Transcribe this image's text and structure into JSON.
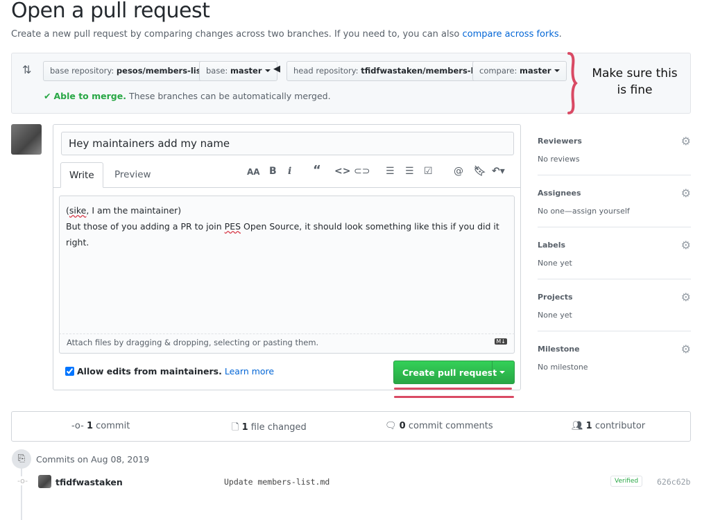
{
  "page": {
    "title": "Open a pull request",
    "subtitle": "Create a new pull request by comparing changes across two branches. If you need to, you can also ",
    "subtitle_link": "compare across forks",
    "subtitle_end": "."
  },
  "compare": {
    "base_repo_label": "base repository:",
    "base_repo": "pesos/members-list",
    "base_label": "base:",
    "base": "master",
    "head_repo_label": "head repository:",
    "head_repo": "tfidfwastaken/members-list",
    "compare_label": "compare:",
    "compare": "master",
    "merge_status": "Able to merge.",
    "merge_text": "These branches can be automatically merged."
  },
  "annotation": {
    "line1": "Make sure this",
    "line2": "is fine",
    "color": "#d94a64"
  },
  "form": {
    "title_value": "Hey maintainers add my name",
    "tabs": [
      "Write",
      "Preview"
    ],
    "toolbar": [
      "header-icon",
      "bold-icon",
      "italic-icon",
      "quote-icon",
      "code-icon",
      "link-icon",
      "bulleted-list-icon",
      "numbered-list-icon",
      "task-list-icon",
      "mention-icon",
      "saved-reply-icon",
      "reply-icon"
    ],
    "body_line1_pre": "(",
    "body_line1_sq": "sike",
    "body_line1_post": ", I am the maintainer)",
    "body_line2_pre": "But those of you adding a PR to join ",
    "body_line2_sq": "PES",
    "body_line2_post": " Open Source, it should look something like this if you did it right.",
    "attach": "Attach files by dragging & dropping, selecting or pasting them.",
    "allow_edits": "Allow edits from maintainers.",
    "learn_more": "Learn more",
    "allow_edits_checked": true,
    "create_button": "Create pull request"
  },
  "sidebar": [
    {
      "label": "Reviewers",
      "value": "No reviews"
    },
    {
      "label": "Assignees",
      "value": "No one—assign yourself"
    },
    {
      "label": "Labels",
      "value": "None yet"
    },
    {
      "label": "Projects",
      "value": "None yet"
    },
    {
      "label": "Milestone",
      "value": "No milestone"
    }
  ],
  "stats": {
    "commits_n": "1",
    "commits": "commit",
    "files_n": "1",
    "files": "file changed",
    "comments_n": "0",
    "comments": "commit comments",
    "contrib_n": "1",
    "contrib": "contributor"
  },
  "commits": {
    "date": "Commits on Aug 08, 2019",
    "items": [
      {
        "author": "tfidfwastaken",
        "message": "Update members-list.md",
        "badge": "Verified",
        "sha": "626c62b"
      }
    ]
  }
}
